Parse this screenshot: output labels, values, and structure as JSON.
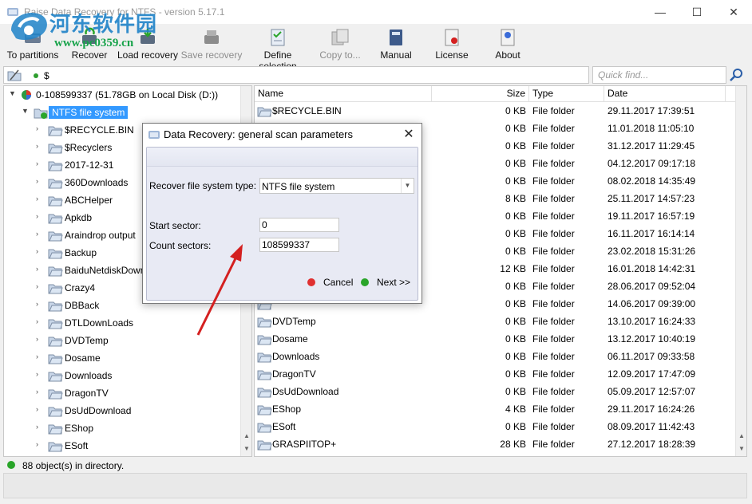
{
  "window": {
    "title": "Raise Data Recovery for NTFS - version 5.17.1",
    "minimize_icon": "minimize-icon",
    "maximize_icon": "maximize-icon",
    "close_icon": "close-icon"
  },
  "watermark": {
    "text": "河东软件园",
    "url": "www.pc0359.cn"
  },
  "toolbar": {
    "items": [
      {
        "label": "To partitions",
        "icon": "partitions-icon",
        "enabled": true
      },
      {
        "label": "Recover",
        "icon": "recover-icon",
        "enabled": true
      },
      {
        "label": "Load recovery",
        "icon": "load-recovery-icon",
        "enabled": true
      },
      {
        "label": "Save recovery",
        "icon": "save-recovery-icon",
        "enabled": false
      },
      {
        "label": "Define selection",
        "icon": "define-selection-icon",
        "enabled": true
      },
      {
        "label": "Copy to...",
        "icon": "copy-to-icon",
        "enabled": false
      },
      {
        "label": "Manual",
        "icon": "manual-icon",
        "enabled": true
      },
      {
        "label": "License",
        "icon": "license-icon",
        "enabled": true
      },
      {
        "label": "About",
        "icon": "about-icon",
        "enabled": true
      }
    ]
  },
  "address": {
    "path": "$",
    "quick_find_placeholder": "Quick find..."
  },
  "tree": {
    "root": "0-108599337 (51.78GB on Local Disk (D:))",
    "selected": "NTFS file system",
    "children": [
      "$RECYCLE.BIN",
      "$Recyclers",
      "2017-12-31",
      "360Downloads",
      "ABCHelper",
      "Apkdb",
      "Araindrop output",
      "Backup",
      "BaiduNetdiskDownload",
      "Crazy4",
      "DBBack",
      "DTLDownLoads",
      "DVDTemp",
      "Dosame",
      "Downloads",
      "DragonTV",
      "DsUdDownload",
      "EShop",
      "ESoft"
    ]
  },
  "list": {
    "columns": {
      "name": "Name",
      "size": "Size",
      "type": "Type",
      "date": "Date"
    },
    "rows": [
      {
        "name": "$RECYCLE.BIN",
        "size": "0 KB",
        "type": "File folder",
        "date": "29.11.2017 17:39:51"
      },
      {
        "name": "",
        "size": "0 KB",
        "type": "File folder",
        "date": "11.01.2018 11:05:10"
      },
      {
        "name": "",
        "size": "0 KB",
        "type": "File folder",
        "date": "31.12.2017 11:29:45"
      },
      {
        "name": "",
        "size": "0 KB",
        "type": "File folder",
        "date": "04.12.2017 09:17:18"
      },
      {
        "name": "",
        "size": "0 KB",
        "type": "File folder",
        "date": "08.02.2018 14:35:49"
      },
      {
        "name": "",
        "size": "8 KB",
        "type": "File folder",
        "date": "25.11.2017 14:57:23"
      },
      {
        "name": "",
        "size": "0 KB",
        "type": "File folder",
        "date": "19.11.2017 16:57:19"
      },
      {
        "name": "",
        "size": "0 KB",
        "type": "File folder",
        "date": "16.11.2017 16:14:14"
      },
      {
        "name": "",
        "size": "0 KB",
        "type": "File folder",
        "date": "23.02.2018 15:31:26"
      },
      {
        "name": "",
        "size": "12 KB",
        "type": "File folder",
        "date": "16.01.2018 14:42:31"
      },
      {
        "name": "",
        "size": "0 KB",
        "type": "File folder",
        "date": "28.06.2017 09:52:04"
      },
      {
        "name": "",
        "size": "0 KB",
        "type": "File folder",
        "date": "14.06.2017 09:39:00"
      },
      {
        "name": "DVDTemp",
        "size": "0 KB",
        "type": "File folder",
        "date": "13.10.2017 16:24:33"
      },
      {
        "name": "Dosame",
        "size": "0 KB",
        "type": "File folder",
        "date": "13.12.2017 10:40:19"
      },
      {
        "name": "Downloads",
        "size": "0 KB",
        "type": "File folder",
        "date": "06.11.2017 09:33:58"
      },
      {
        "name": "DragonTV",
        "size": "0 KB",
        "type": "File folder",
        "date": "12.09.2017 17:47:09"
      },
      {
        "name": "DsUdDownload",
        "size": "0 KB",
        "type": "File folder",
        "date": "05.09.2017 12:57:07"
      },
      {
        "name": "EShop",
        "size": "4 KB",
        "type": "File folder",
        "date": "29.11.2017 16:24:26"
      },
      {
        "name": "ESoft",
        "size": "0 KB",
        "type": "File folder",
        "date": "08.09.2017 11:42:43"
      },
      {
        "name": "GRASPIITOP+",
        "size": "28 KB",
        "type": "File folder",
        "date": "27.12.2017 18:28:39"
      }
    ]
  },
  "status": {
    "text": "88 object(s) in directory."
  },
  "dialog": {
    "title": "Data Recovery: general scan parameters",
    "fs_type_label": "Recover file system type:",
    "fs_type_value": "NTFS file system",
    "start_sector_label": "Start sector:",
    "start_sector_value": "0",
    "count_sectors_label": "Count sectors:",
    "count_sectors_value": "108599337",
    "cancel_label": "Cancel",
    "next_label": "Next >>",
    "cancel_color": "#e03030",
    "next_color": "#2aa52a"
  },
  "colors": {
    "selection": "#3399ff",
    "annotation_arrow": "#d42020"
  }
}
